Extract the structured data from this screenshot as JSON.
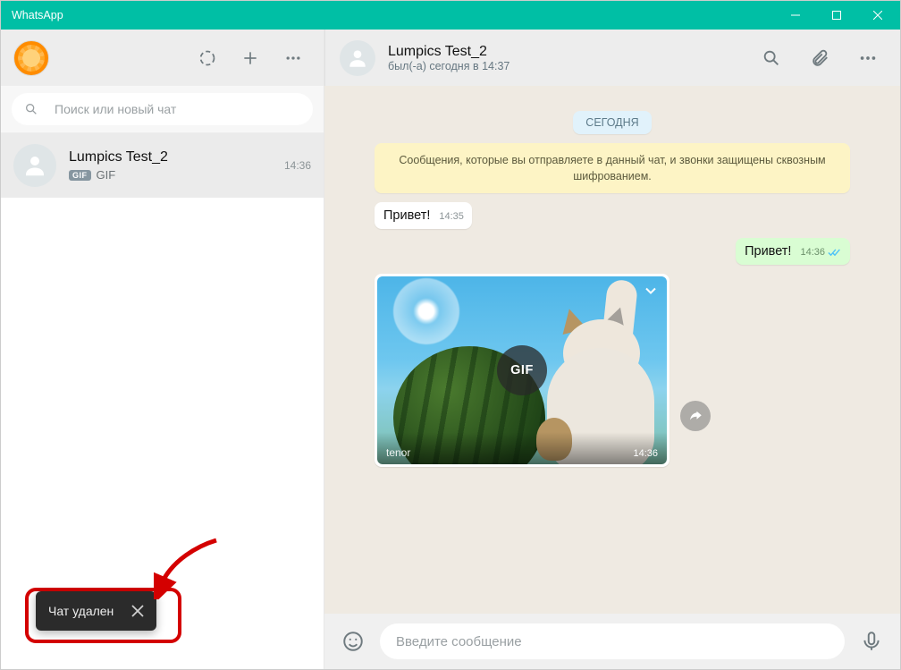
{
  "window": {
    "title": "WhatsApp"
  },
  "sidebar": {
    "search_placeholder": "Поиск или новый чат",
    "chats": [
      {
        "name": "Lumpics Test_2",
        "preview_kind": "GIF",
        "preview_text": "GIF",
        "time": "14:36"
      }
    ]
  },
  "conversation": {
    "contact_name": "Lumpics Test_2",
    "contact_status": "был(-а) сегодня в 14:37",
    "date_label": "СЕГОДНЯ",
    "encryption_notice": "Сообщения, которые вы отправляете в данный чат, и звонки защищены сквозным шифрованием.",
    "messages": [
      {
        "dir": "in",
        "type": "text",
        "text": "Привет!",
        "time": "14:35"
      },
      {
        "dir": "out",
        "type": "text",
        "text": "Привет!",
        "time": "14:36"
      },
      {
        "dir": "in",
        "type": "gif",
        "badge": "GIF",
        "source": "tenor",
        "time": "14:36"
      }
    ],
    "composer_placeholder": "Введите сообщение"
  },
  "toast": {
    "text": "Чат удален"
  }
}
